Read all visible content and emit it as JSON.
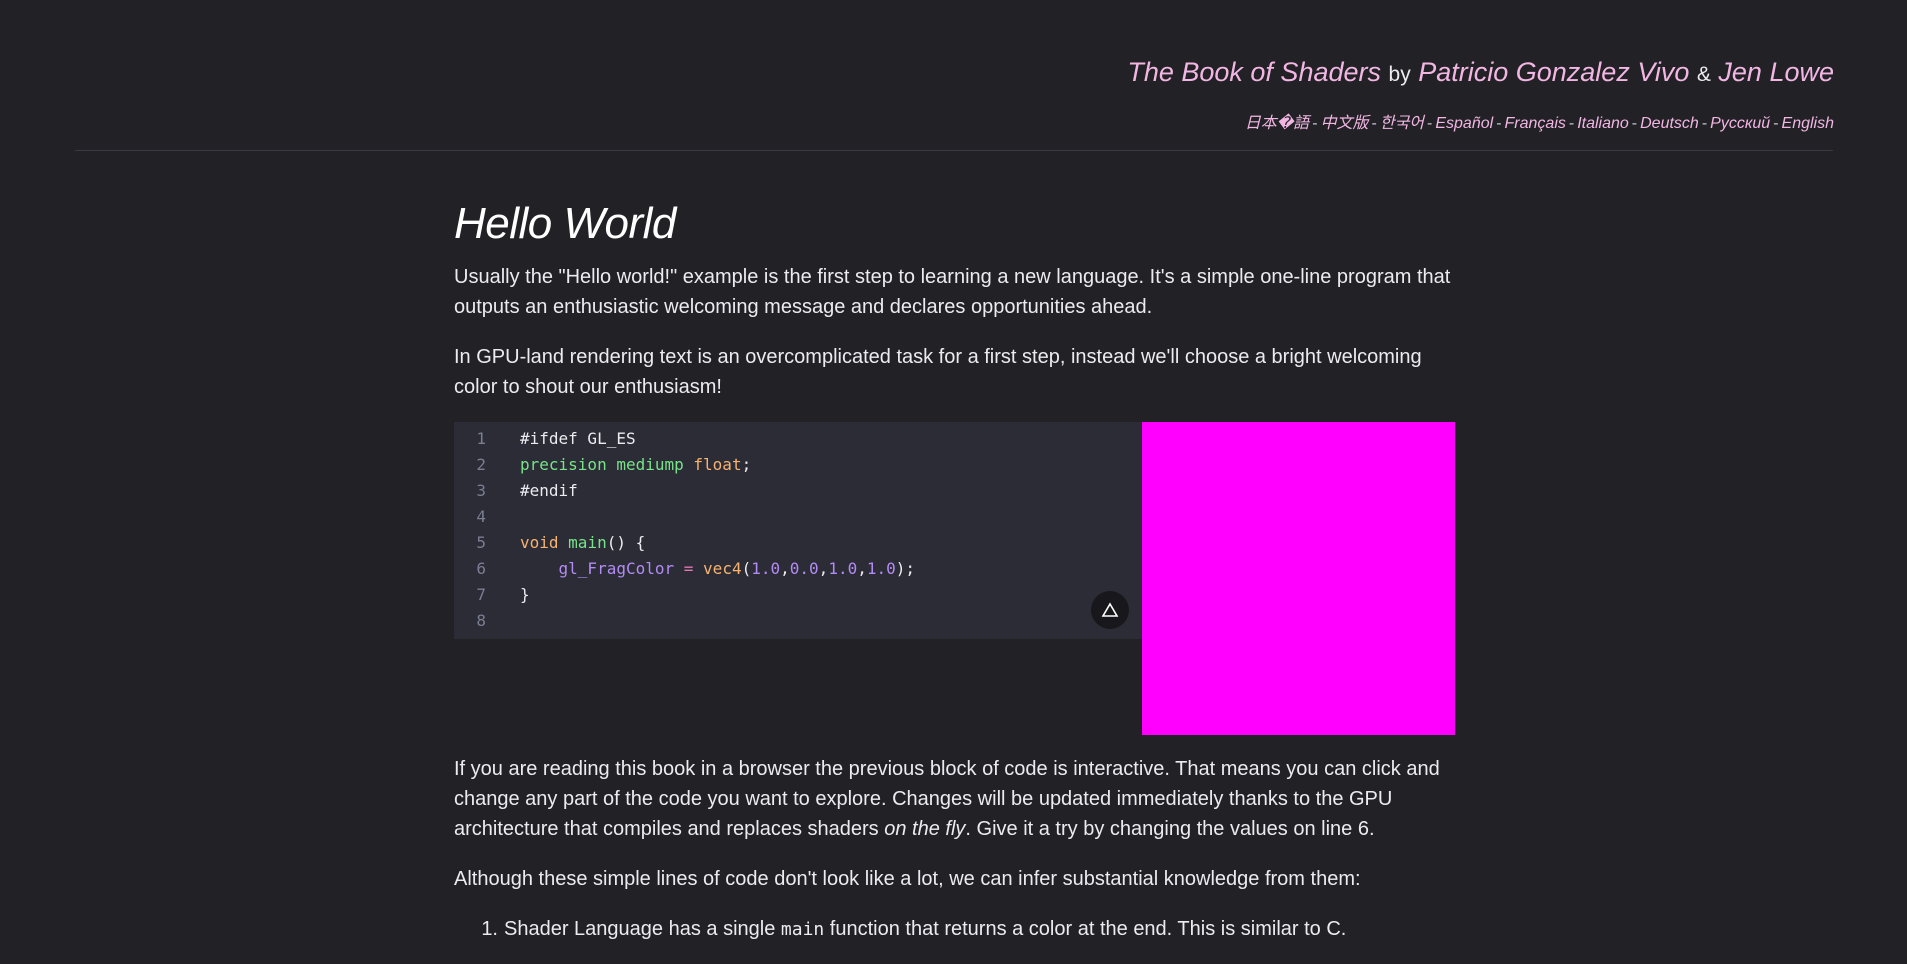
{
  "header": {
    "book_title": "The Book of Shaders",
    "by": "by",
    "author_1": "Patricio Gonzalez Vivo",
    "amp": "&",
    "author_2": "Jen Lowe",
    "languages": [
      "日本�語",
      "中文版",
      "한국어",
      "Español",
      "Français",
      "Italiano",
      "Deutsch",
      "Русский",
      "English"
    ],
    "separator": "-"
  },
  "main": {
    "title": "Hello World",
    "intro_1": "Usually the \"Hello world!\" example is the first step to learning a new language. It's a simple one-line program that outputs an enthusiastic welcoming message and declares opportunities ahead.",
    "intro_2": "In GPU-land rendering text is an overcomplicated task for a first step, instead we'll choose a bright welcoming color to shout our enthusiasm!",
    "code": {
      "lines": [
        {
          "n": "1",
          "tokens": [
            {
              "t": "#ifdef GL_ES",
              "c": "pre"
            }
          ]
        },
        {
          "n": "2",
          "tokens": [
            {
              "t": "precision mediump",
              "c": "green"
            },
            {
              "t": " ",
              "c": "plain"
            },
            {
              "t": "float",
              "c": "orange"
            },
            {
              "t": ";",
              "c": "plain"
            }
          ]
        },
        {
          "n": "3",
          "tokens": [
            {
              "t": "#endif",
              "c": "pre"
            }
          ]
        },
        {
          "n": "4",
          "tokens": []
        },
        {
          "n": "5",
          "tokens": [
            {
              "t": "void",
              "c": "orange"
            },
            {
              "t": " ",
              "c": "plain"
            },
            {
              "t": "main",
              "c": "green"
            },
            {
              "t": "() {",
              "c": "plain"
            }
          ]
        },
        {
          "n": "6",
          "tokens": [
            {
              "t": "    ",
              "c": "plain"
            },
            {
              "t": "gl_FragColor",
              "c": "purple"
            },
            {
              "t": " ",
              "c": "plain"
            },
            {
              "t": "=",
              "c": "pink"
            },
            {
              "t": " ",
              "c": "plain"
            },
            {
              "t": "vec4",
              "c": "orange"
            },
            {
              "t": "(",
              "c": "plain"
            },
            {
              "t": "1.0",
              "c": "purple"
            },
            {
              "t": ",",
              "c": "plain"
            },
            {
              "t": "0.0",
              "c": "purple"
            },
            {
              "t": ",",
              "c": "plain"
            },
            {
              "t": "1.0",
              "c": "purple"
            },
            {
              "t": ",",
              "c": "plain"
            },
            {
              "t": "1.0",
              "c": "purple"
            },
            {
              "t": ");",
              "c": "plain"
            }
          ]
        },
        {
          "n": "7",
          "tokens": [
            {
              "t": "}",
              "c": "plain"
            }
          ]
        },
        {
          "n": "8",
          "tokens": []
        }
      ],
      "export_icon": "triangle-up-icon"
    },
    "canvas_color": "#ff00ff",
    "body_1_parts": [
      {
        "t": "If you are reading this book in a browser the previous block of code is interactive. That means you can click and change any part of the code you want to explore. Changes will be updated immediately thanks to the GPU architecture that compiles and replaces shaders ",
        "em": false
      },
      {
        "t": "on the fly",
        "em": true
      },
      {
        "t": ". Give it a try by changing the values on line 6.",
        "em": false
      }
    ],
    "body_2": "Although these simple lines of code don't look like a lot, we can infer substantial knowledge from them:",
    "list": [
      {
        "num": "1.",
        "before": "Shader Language has a single ",
        "code": "main",
        "after": " function that returns a color at the end. This is similar to C."
      }
    ]
  },
  "colors": {
    "background": "#212126",
    "link": "#f2b6e3",
    "code_bg": "#2b2c36"
  }
}
